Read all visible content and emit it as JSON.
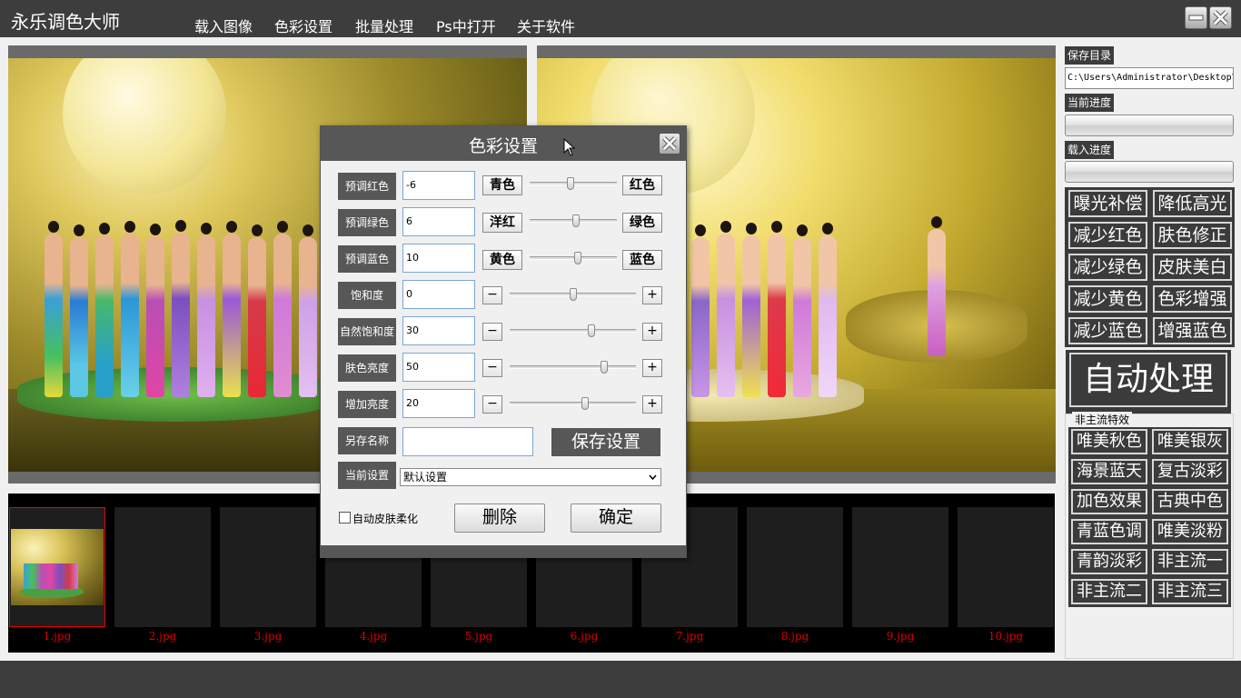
{
  "app": {
    "title": "永乐调色大师",
    "menu": [
      "载入图像",
      "色彩设置",
      "批量处理",
      "Ps中打开",
      "关于软件"
    ]
  },
  "window_controls": {
    "minimize": "minimize-icon",
    "close": "close-icon"
  },
  "filmstrip": {
    "items": [
      "1.jpg",
      "2.jpg",
      "3.jpg",
      "4.jpg",
      "5.jpg",
      "6.jpg",
      "7.jpg",
      "8.jpg",
      "9.jpg",
      "10.jpg"
    ],
    "selected_index": 0
  },
  "right_panel": {
    "save_dir_label": "保存目录",
    "save_dir_value": "C:\\Users\\Administrator\\Desktop\\",
    "current_progress_label": "当前进度",
    "load_progress_label": "载入进度",
    "current_progress": 0,
    "load_progress": 0,
    "quick_buttons": [
      "曝光补偿",
      "降低高光",
      "减少红色",
      "肤色修正",
      "减少绿色",
      "皮肤美白",
      "减少黄色",
      "色彩增强",
      "减少蓝色",
      "增强蓝色"
    ],
    "auto_button": "自动处理",
    "effects_legend": "非主流特效",
    "effects": [
      "唯美秋色",
      "唯美银灰",
      "海景蓝天",
      "复古淡彩",
      "加色效果",
      "古典中色",
      "青蓝色调",
      "唯美淡粉",
      "青韵淡彩",
      "非主流一",
      "非主流二",
      "非主流三"
    ]
  },
  "dialog": {
    "title": "色彩设置",
    "color_rows": [
      {
        "label": "预调红色",
        "value": "-6",
        "left": "青色",
        "right": "红色",
        "level": 0.47
      },
      {
        "label": "预调绿色",
        "value": "6",
        "left": "洋红",
        "right": "绿色",
        "level": 0.53
      },
      {
        "label": "预调蓝色",
        "value": "10",
        "left": "黄色",
        "right": "蓝色",
        "level": 0.55
      }
    ],
    "adjust_rows": [
      {
        "label": "饱和度",
        "value": "0",
        "minus": "−",
        "plus": "+",
        "level": 0.5
      },
      {
        "label": "自然饱和度",
        "value": "30",
        "minus": "−",
        "plus": "+",
        "level": 0.65
      },
      {
        "label": "肤色亮度",
        "value": "50",
        "minus": "−",
        "plus": "+",
        "level": 0.75
      },
      {
        "label": "增加亮度",
        "value": "20",
        "minus": "−",
        "plus": "+",
        "level": 0.6
      }
    ],
    "save_as_label": "另存名称",
    "save_as_value": "",
    "save_button": "保存设置",
    "current_setting_label": "当前设置",
    "current_setting_value": "默认设置",
    "auto_skin_soften": "自动皮肤柔化",
    "auto_skin_soften_checked": false,
    "delete_button": "删除",
    "ok_button": "确定"
  }
}
